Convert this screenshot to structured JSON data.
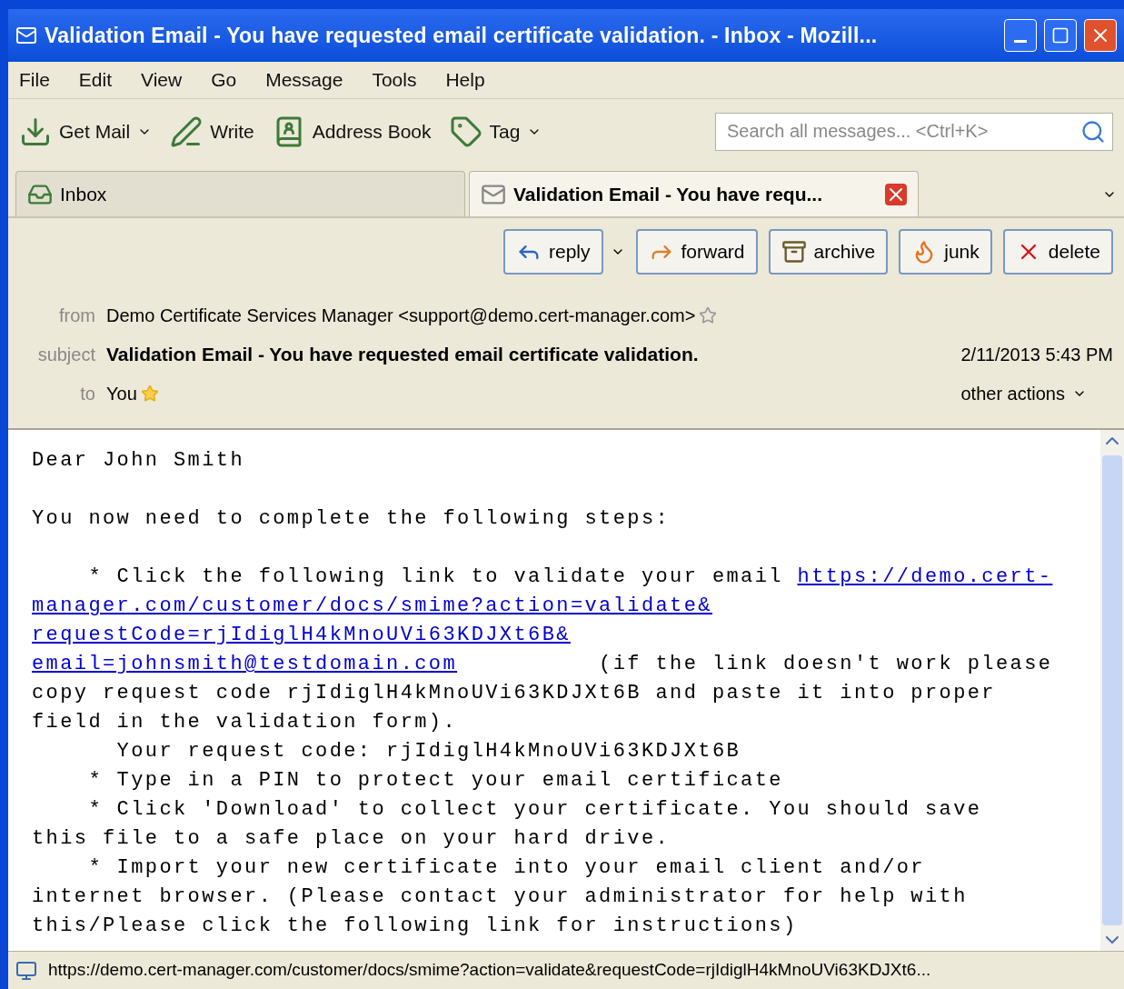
{
  "window": {
    "title": "Validation Email - You have requested email certificate validation. - Inbox - Mozill..."
  },
  "menu": [
    "File",
    "Edit",
    "View",
    "Go",
    "Message",
    "Tools",
    "Help"
  ],
  "toolbar": [
    {
      "kind": "getmail",
      "label": "Get Mail",
      "dropdown": true
    },
    {
      "kind": "write",
      "label": "Write",
      "dropdown": false
    },
    {
      "kind": "addressbook",
      "label": "Address Book",
      "dropdown": false
    },
    {
      "kind": "tag",
      "label": "Tag",
      "dropdown": true
    }
  ],
  "search": {
    "placeholder": "Search all messages... <Ctrl+K>"
  },
  "tabs": [
    {
      "kind": "folder",
      "label": "Inbox",
      "selected": false
    },
    {
      "kind": "message",
      "label": "Validation Email - You have requ...",
      "selected": true
    }
  ],
  "actions": [
    {
      "kind": "reply",
      "label": "reply",
      "dropdown": true
    },
    {
      "kind": "forward",
      "label": "forward",
      "dropdown": false
    },
    {
      "kind": "archive",
      "label": "archive",
      "dropdown": false
    },
    {
      "kind": "junk",
      "label": "junk",
      "dropdown": false
    },
    {
      "kind": "delete",
      "label": "delete",
      "dropdown": false
    }
  ],
  "header": {
    "from_label": "from",
    "from": "Demo Certificate Services Manager <support@demo.cert-manager.com>",
    "from_starred": false,
    "subject_label": "subject",
    "subject": "Validation Email - You have requested email certificate validation.",
    "date": "2/11/2013 5:43 PM",
    "to_label": "to",
    "to": "You",
    "to_starred": true,
    "other_actions": "other actions"
  },
  "body": [
    {
      "kind": "text",
      "parts": [
        {
          "text": "Dear John Smith",
          "link": false
        }
      ]
    },
    {
      "kind": "gap"
    },
    {
      "kind": "text",
      "parts": [
        {
          "text": "You now need to complete the following steps:",
          "link": false
        }
      ]
    },
    {
      "kind": "gap"
    },
    {
      "kind": "text",
      "parts": [
        {
          "text": "    * Click the following link to validate your email ",
          "link": false
        },
        {
          "text": "https://demo.cert-",
          "link": true
        }
      ]
    },
    {
      "kind": "text",
      "parts": [
        {
          "text": "manager.com/customer/docs/smime?action=validate&",
          "link": true
        }
      ]
    },
    {
      "kind": "text",
      "parts": [
        {
          "text": "requestCode=rjIdiglH4kMnoUVi63KDJXt6B&",
          "link": true
        }
      ]
    },
    {
      "kind": "text",
      "parts": [
        {
          "text": "email=johnsmith@testdomain.com",
          "link": true
        },
        {
          "text": "          (if the link doesn't work please",
          "link": false
        }
      ]
    },
    {
      "kind": "text",
      "parts": [
        {
          "text": "copy request code rjIdiglH4kMnoUVi63KDJXt6B and paste it into proper",
          "link": false
        }
      ]
    },
    {
      "kind": "text",
      "parts": [
        {
          "text": "field in the validation form).",
          "link": false
        }
      ]
    },
    {
      "kind": "text",
      "parts": [
        {
          "text": "      Your request code: rjIdiglH4kMnoUVi63KDJXt6B",
          "link": false
        }
      ]
    },
    {
      "kind": "text",
      "parts": [
        {
          "text": "    * Type in a PIN to protect your email certificate",
          "link": false
        }
      ]
    },
    {
      "kind": "text",
      "parts": [
        {
          "text": "    * Click 'Download' to collect your certificate. You should save",
          "link": false
        }
      ]
    },
    {
      "kind": "text",
      "parts": [
        {
          "text": "this file to a safe place on your hard drive.",
          "link": false
        }
      ]
    },
    {
      "kind": "text",
      "parts": [
        {
          "text": "    * Import your new certificate into your email client and/or",
          "link": false
        }
      ]
    },
    {
      "kind": "text",
      "parts": [
        {
          "text": "internet browser. (Please contact your administrator for help with",
          "link": false
        }
      ]
    },
    {
      "kind": "text",
      "parts": [
        {
          "text": "this/Please click the following link for instructions)",
          "link": false
        }
      ]
    }
  ],
  "status_bar": {
    "text": "https://demo.cert-manager.com/customer/docs/smime?action=validate&requestCode=rjIdiglH4kMnoUVi63KDJXt6..."
  }
}
